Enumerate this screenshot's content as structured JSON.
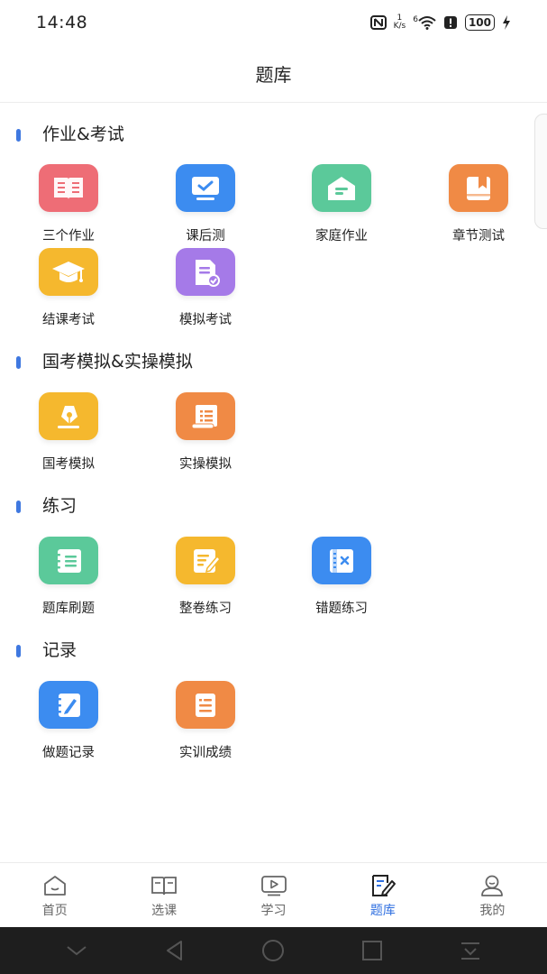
{
  "status_bar": {
    "time": "14:48",
    "net_speed_value": "1",
    "net_speed_unit": "K/s",
    "signal_label": "6",
    "battery": "100"
  },
  "header": {
    "title": "题库"
  },
  "sections": [
    {
      "title": "作业&考试",
      "items": [
        {
          "label": "三个作业",
          "icon": "book-icon",
          "color": "#ee6d76"
        },
        {
          "label": "课后测",
          "icon": "monitor-check-icon",
          "color": "#3c8cf0"
        },
        {
          "label": "家庭作业",
          "icon": "house-icon",
          "color": "#5bc99a"
        },
        {
          "label": "章节测试",
          "icon": "bookmark-book-icon",
          "color": "#f08a45"
        },
        {
          "label": "结课考试",
          "icon": "graduation-cap-icon",
          "color": "#f5b82e"
        },
        {
          "label": "模拟考试",
          "icon": "document-check-icon",
          "color": "#a57ae8"
        }
      ]
    },
    {
      "title": "国考模拟&实操模拟",
      "items": [
        {
          "label": "国考模拟",
          "icon": "pen-nib-icon",
          "color": "#f5b82e"
        },
        {
          "label": "实操模拟",
          "icon": "scroll-list-icon",
          "color": "#f08a45"
        }
      ]
    },
    {
      "title": "练习",
      "items": [
        {
          "label": "题库刷题",
          "icon": "notebook-icon",
          "color": "#5bc99a"
        },
        {
          "label": "整卷练习",
          "icon": "edit-paper-icon",
          "color": "#f5b82e"
        },
        {
          "label": "错题练习",
          "icon": "wrong-book-icon",
          "color": "#3c8cf0"
        }
      ]
    },
    {
      "title": "记录",
      "items": [
        {
          "label": "做题记录",
          "icon": "record-edit-icon",
          "color": "#3c8cf0"
        },
        {
          "label": "实训成绩",
          "icon": "score-sheet-icon",
          "color": "#f08a45"
        }
      ]
    }
  ],
  "tabbar": {
    "items": [
      {
        "label": "首页",
        "icon": "home-icon"
      },
      {
        "label": "选课",
        "icon": "open-book-icon"
      },
      {
        "label": "学习",
        "icon": "play-screen-icon"
      },
      {
        "label": "题库",
        "icon": "question-bank-icon",
        "active": true
      },
      {
        "label": "我的",
        "icon": "profile-icon"
      }
    ]
  },
  "colors": {
    "accent": "#2f6fe0",
    "section_marker": "#3f78e0",
    "inactive_tab": "#666666"
  }
}
